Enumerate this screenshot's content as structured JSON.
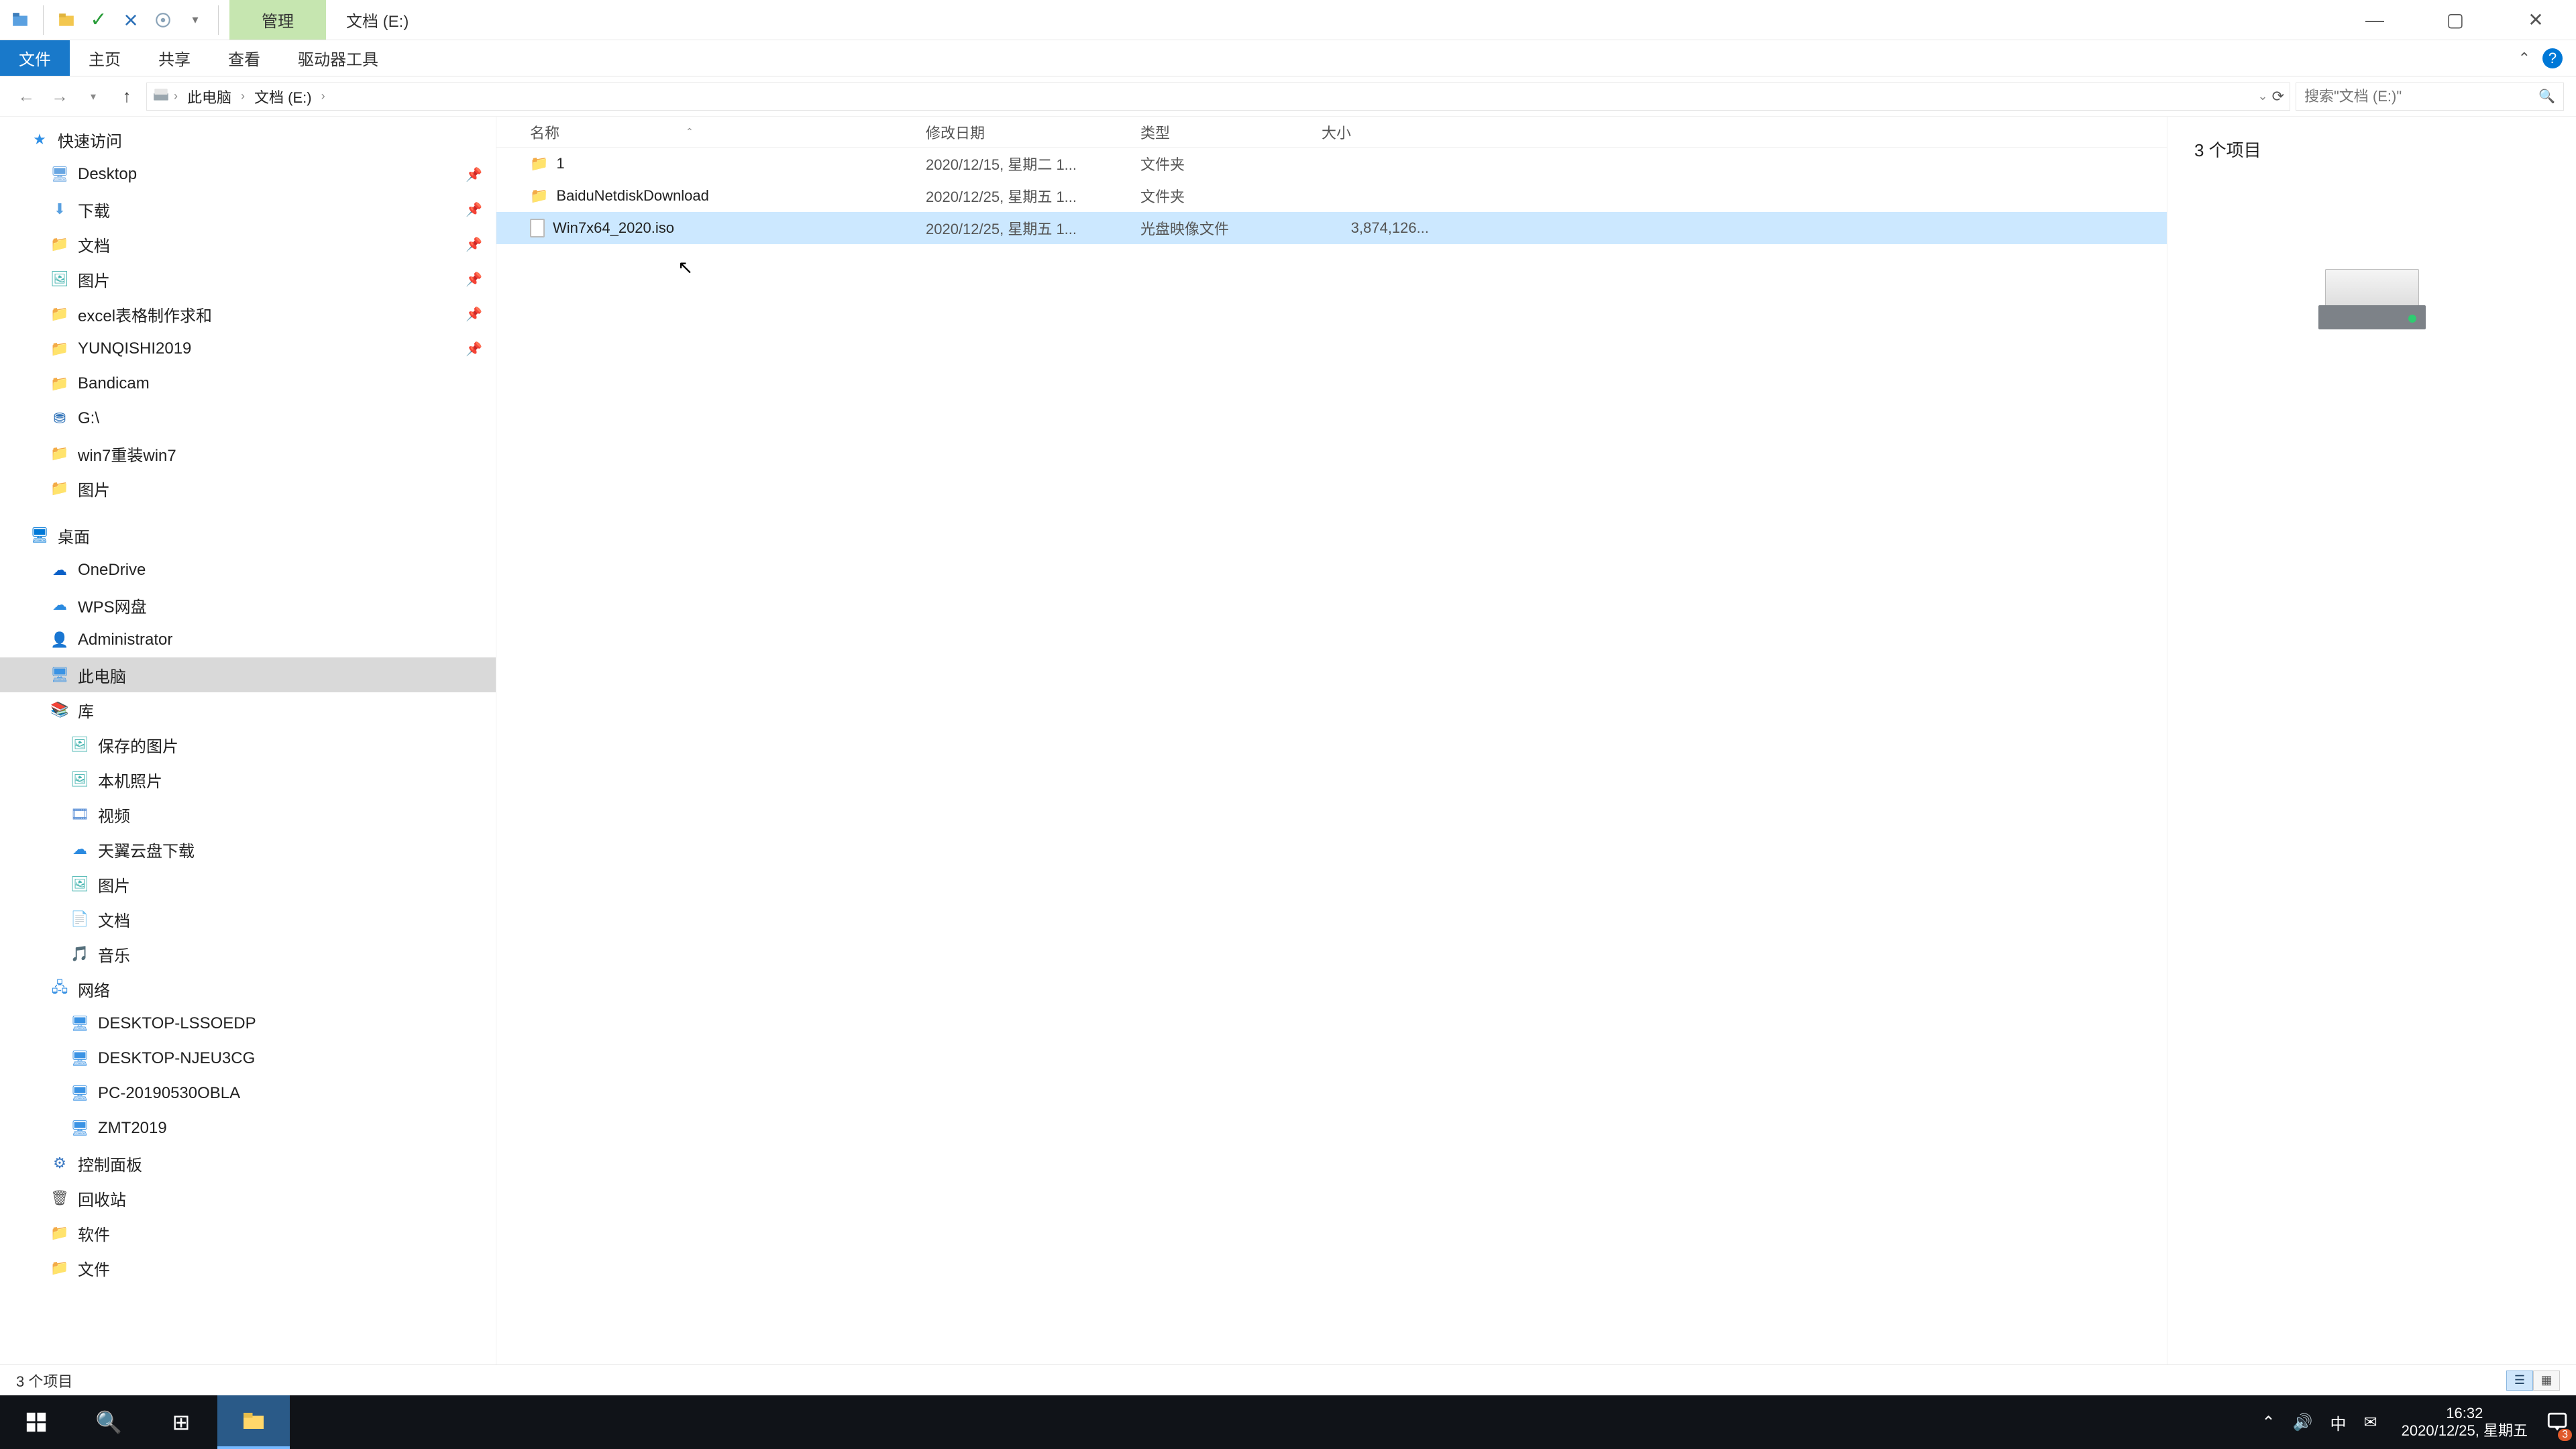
{
  "title_tabs": {
    "manage": "管理",
    "location": "文档 (E:)"
  },
  "ribbon": {
    "file": "文件",
    "home": "主页",
    "share": "共享",
    "view": "查看",
    "drive_tools": "驱动器工具"
  },
  "breadcrumb": {
    "pc": "此电脑",
    "drive": "文档 (E:)"
  },
  "search": {
    "placeholder": "搜索\"文档 (E:)\""
  },
  "nav": {
    "quick_access": "快速访问",
    "qa_items": [
      {
        "label": "Desktop",
        "icon": "folder-blue"
      },
      {
        "label": "下载",
        "icon": "down"
      },
      {
        "label": "文档",
        "icon": "folder"
      },
      {
        "label": "图片",
        "icon": "image"
      },
      {
        "label": "excel表格制作求和",
        "icon": "folder"
      },
      {
        "label": "YUNQISHI2019",
        "icon": "folder-blue"
      },
      {
        "label": "Bandicam",
        "icon": "folder"
      },
      {
        "label": "G:\\",
        "icon": "g"
      },
      {
        "label": "win7重装win7",
        "icon": "folder"
      },
      {
        "label": "图片",
        "icon": "folder"
      }
    ],
    "desktop": "桌面",
    "onedrive": "OneDrive",
    "wps": "WPS网盘",
    "admin": "Administrator",
    "this_pc": "此电脑",
    "library": "库",
    "lib_items": [
      {
        "label": "保存的图片",
        "icon": "image"
      },
      {
        "label": "本机照片",
        "icon": "image"
      },
      {
        "label": "视频",
        "icon": "video"
      },
      {
        "label": "天翼云盘下载",
        "icon": "cloud2"
      },
      {
        "label": "图片",
        "icon": "image"
      },
      {
        "label": "文档",
        "icon": "folder"
      },
      {
        "label": "音乐",
        "icon": "folder"
      }
    ],
    "network": "网络",
    "net_items": [
      {
        "label": "DESKTOP-LSSOEDP"
      },
      {
        "label": "DESKTOP-NJEU3CG"
      },
      {
        "label": "PC-20190530OBLA"
      },
      {
        "label": "ZMT2019"
      }
    ],
    "control_panel": "控制面板",
    "recycle": "回收站",
    "software": "软件",
    "docs": "文件"
  },
  "columns": {
    "name": "名称",
    "date": "修改日期",
    "type": "类型",
    "size": "大小"
  },
  "rows": [
    {
      "name": "1",
      "date": "2020/12/15, 星期二 1...",
      "type": "文件夹",
      "size": "",
      "icon": "folder",
      "selected": false
    },
    {
      "name": "BaiduNetdiskDownload",
      "date": "2020/12/25, 星期五 1...",
      "type": "文件夹",
      "size": "",
      "icon": "folder",
      "selected": false
    },
    {
      "name": "Win7x64_2020.iso",
      "date": "2020/12/25, 星期五 1...",
      "type": "光盘映像文件",
      "size": "3,874,126...",
      "icon": "iso",
      "selected": true
    }
  ],
  "preview": {
    "count_label": "3 个项目"
  },
  "status": {
    "text": "3 个项目"
  },
  "taskbar": {
    "time": "16:32",
    "date": "2020/12/25, 星期五",
    "ime": "中",
    "notif_count": "3"
  }
}
